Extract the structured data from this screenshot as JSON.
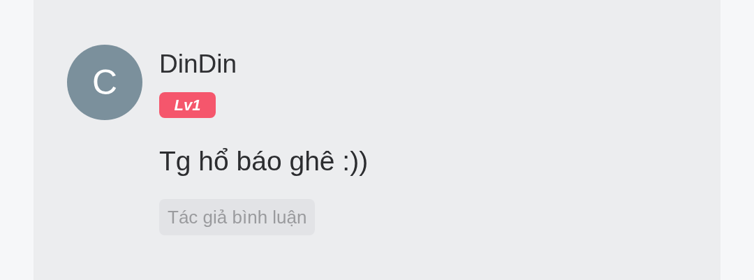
{
  "comment": {
    "avatar_letter": "C",
    "author": "DinDin",
    "level_badge": "Lv1",
    "text": "Tg hổ báo ghê :))",
    "tag": "Tác giả bình luận"
  }
}
